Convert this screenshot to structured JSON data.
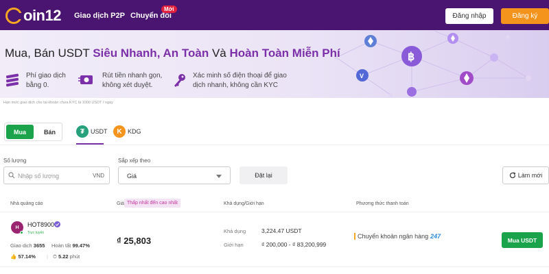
{
  "header": {
    "logo_text": "oin12",
    "nav": [
      {
        "label": "Giao dịch P2P"
      },
      {
        "label": "Chuyển đổi"
      }
    ],
    "new_badge": "Mới",
    "login_label": "Đăng nhập",
    "register_label": "Đăng ký"
  },
  "hero": {
    "title_prefix": "Mua, Bán USDT ",
    "title_hl1": "Siêu Nhanh, An Toàn",
    "title_mid": " Và ",
    "title_hl2": "Hoàn Toàn Miễn Phí",
    "features": [
      {
        "line1": "Phí giao dịch",
        "line2": "bằng 0."
      },
      {
        "line1": "Rút tiền nhanh gọn,",
        "line2": "không xét duyệt."
      },
      {
        "line1": "Xác minh số điện thoại để giao",
        "line2": "dịch nhanh, không cần KYC"
      }
    ],
    "note": "Hạn mức giao dịch cho tài khoản chưa KYC là 1000 USDT / ngày"
  },
  "trade_toggle": {
    "buy": "Mua",
    "sell": "Bán"
  },
  "coin_tabs": [
    {
      "label": "USDT",
      "icon": "tether-icon"
    },
    {
      "label": "KDG",
      "icon": "kdg-icon"
    }
  ],
  "filters": {
    "amount_label": "Số lượng",
    "amount_placeholder": "Nhập số lượng",
    "amount_unit": "VND",
    "sort_label": "Sắp xếp theo",
    "sort_value": "Giá",
    "reset_label": "Đặt lại",
    "refresh_label": "Làm mới"
  },
  "table": {
    "headers": {
      "advertiser": "Nhà quảng cáo",
      "price": "Giá",
      "price_sort": "Thấp nhất đến cao nhất",
      "available": "Khả dụng/Giới hạn",
      "payment": "Phương thức thanh toán"
    },
    "rows": [
      {
        "avatar_letter": "H",
        "name": "HOT8900",
        "online": "Trực tuyến",
        "trades_label": "Giao dịch",
        "trades": "3655",
        "completion_label": "Hoàn tất",
        "completion": "99.47%",
        "like_rate": "57.14%",
        "time_value": "5.22",
        "time_unit": "phút",
        "price": "₫ 25,803",
        "available_label": "Khả dụng",
        "available": "3,224.47 USDT",
        "limit_label": "Giới hạn",
        "limit": "₫ 200,000 - ₫ 83,200,999",
        "payment": "Chuyển khoản ngân hàng",
        "payment_badge": "247",
        "action": "Mua USDT"
      }
    ]
  },
  "colors": {
    "header_bg": "#4a1570",
    "accent_purple": "#7b2fa8",
    "green": "#1aa34a",
    "orange": "#f5941d"
  }
}
